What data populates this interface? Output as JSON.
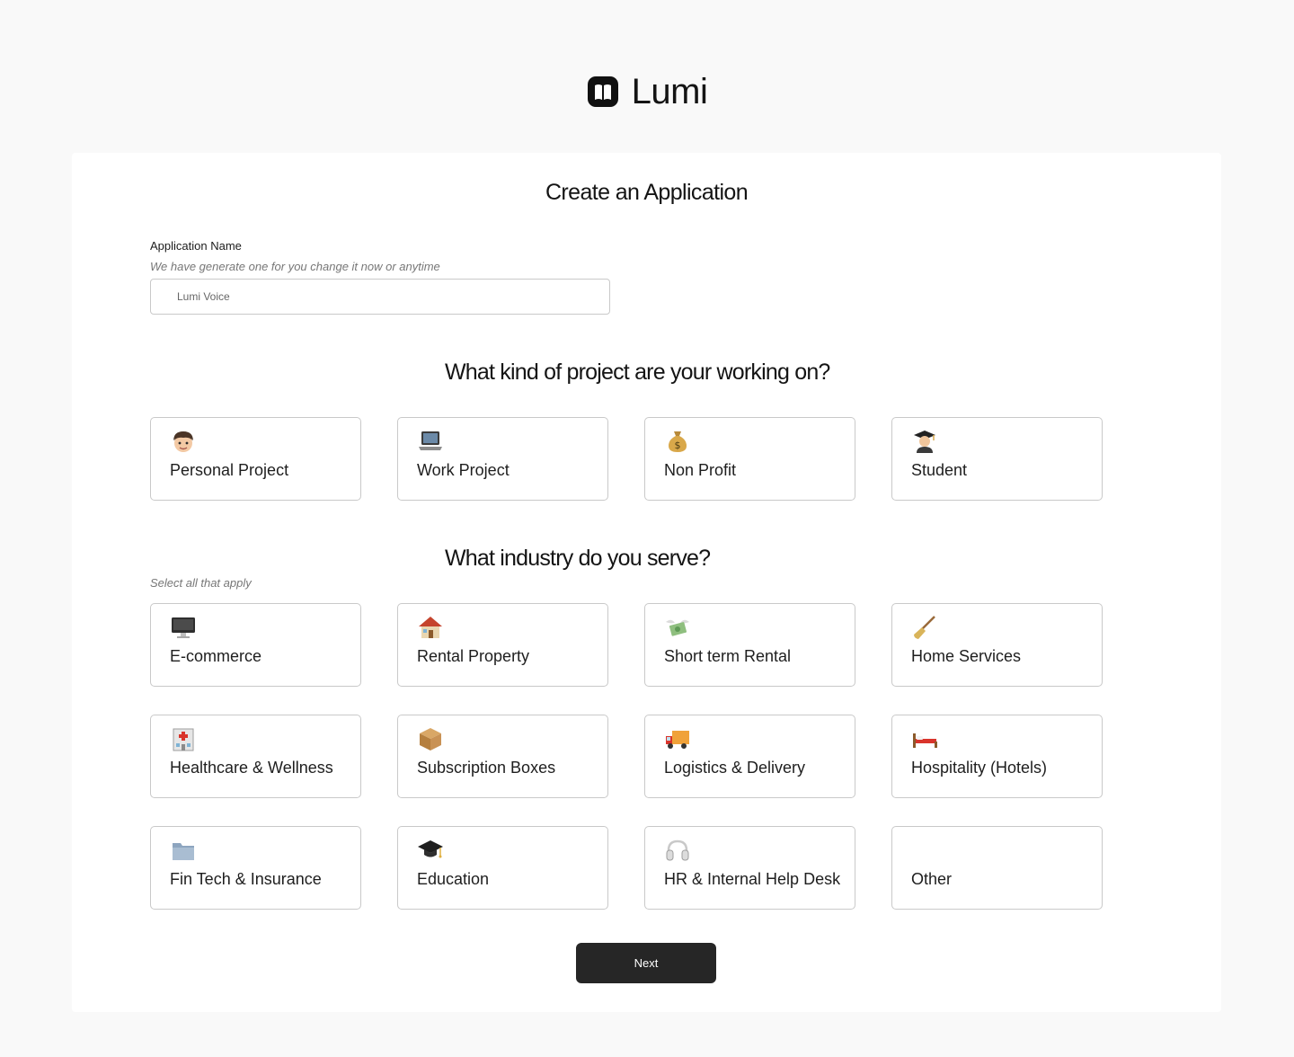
{
  "brand": {
    "name": "Lumi"
  },
  "card_title": "Create an Application",
  "app_name": {
    "label": "Application Name",
    "hint": "We have generate one for you change it now or anytime",
    "value": "",
    "placeholder": "Lumi Voice"
  },
  "project": {
    "title": "What kind of project are your working on?",
    "options": [
      {
        "label": "Personal Project",
        "icon": "person-emoji-icon"
      },
      {
        "label": "Work Project",
        "icon": "laptop-emoji-icon"
      },
      {
        "label": "Non Profit",
        "icon": "money-bag-emoji-icon"
      },
      {
        "label": "Student",
        "icon": "student-emoji-icon"
      }
    ]
  },
  "industry": {
    "title": "What industry do you serve?",
    "hint": "Select all that apply",
    "options": [
      {
        "label": "E-commerce",
        "icon": "desktop-computer-emoji-icon"
      },
      {
        "label": "Rental Property",
        "icon": "house-emoji-icon"
      },
      {
        "label": "Short term Rental",
        "icon": "money-wings-emoji-icon"
      },
      {
        "label": "Home Services",
        "icon": "broom-emoji-icon"
      },
      {
        "label": "Healthcare & Wellness",
        "icon": "hospital-emoji-icon"
      },
      {
        "label": "Subscription Boxes",
        "icon": "package-emoji-icon"
      },
      {
        "label": "Logistics & Delivery",
        "icon": "delivery-truck-emoji-icon"
      },
      {
        "label": "Hospitality (Hotels)",
        "icon": "bed-emoji-icon"
      },
      {
        "label": "Fin Tech & Insurance",
        "icon": "folder-emoji-icon"
      },
      {
        "label": "Education",
        "icon": "graduation-cap-emoji-icon"
      },
      {
        "label": "HR & Internal Help Desk",
        "icon": "headphones-emoji-icon"
      },
      {
        "label": "Other",
        "icon": ""
      }
    ]
  },
  "next_label": "Next",
  "colors": {
    "button_bg": "#262626",
    "border": "#c9c9c9",
    "page_bg": "#f9f9f9",
    "card_bg": "#ffffff"
  }
}
